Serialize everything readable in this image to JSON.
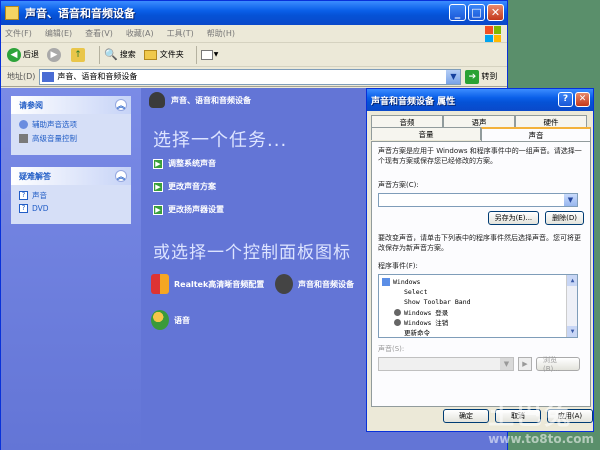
{
  "window": {
    "title": "声音、语音和音频设备",
    "menu": [
      "文件(F)",
      "编辑(E)",
      "查看(V)",
      "收藏(A)",
      "工具(T)",
      "帮助(H)"
    ],
    "toolbar": {
      "back": "后退",
      "search": "搜索",
      "folders": "文件夹"
    },
    "address": {
      "label": "地址(D)",
      "value": "声音、语音和音频设备",
      "go": "转到"
    }
  },
  "sidebar": {
    "see_also": {
      "title": "请参阅",
      "items": [
        "辅助声音选项",
        "高级音量控制"
      ]
    },
    "troubleshoot": {
      "title": "疑难解答",
      "items": [
        "声音",
        "DVD"
      ]
    }
  },
  "main": {
    "header": "声音、语音和音频设备",
    "task_title": "选择一个任务...",
    "tasks": [
      "调整系统声音",
      "更改声音方案",
      "更改扬声器设置"
    ],
    "cp_title": "或选择一个控制面板图标",
    "icons": [
      "Realtek高清晰音频配置",
      "声音和音频设备",
      "语音"
    ]
  },
  "dialog": {
    "title": "声音和音频设备 属性",
    "tabs_back": [
      "音频",
      "语声",
      "硬件"
    ],
    "tabs_front": [
      "音量",
      "声音"
    ],
    "active_tab": "声音",
    "description": "声音方案是应用于 Windows 和程序事件中的一组声音。请选择一个现有方案或保存您已经修改的方案。",
    "scheme_label": "声音方案(C):",
    "scheme_value": "",
    "save_as": "另存为(E)...",
    "delete": "删除(D)",
    "change_desc": "要改变声音，请单击下列表中的程序事件然后选择声音。您可将更改保存为新声音方案。",
    "events_label": "程序事件(F):",
    "events": [
      "Windows",
      "Select",
      "Show Toolbar Band",
      "Windows 登录",
      "Windows 注销",
      "更新命令"
    ],
    "sounds_label": "声音(S):",
    "browse": "浏览(B)...",
    "ok": "确定",
    "cancel": "取消",
    "apply": "应用(A)"
  },
  "watermark": {
    "line1": "土巴兔",
    "line2": "www.to8to.com"
  },
  "colors": {
    "titlebar": "#0552d6",
    "panel_bg": "#6375d6",
    "dialog_bg": "#ece9d8",
    "link": "#215dc6"
  }
}
